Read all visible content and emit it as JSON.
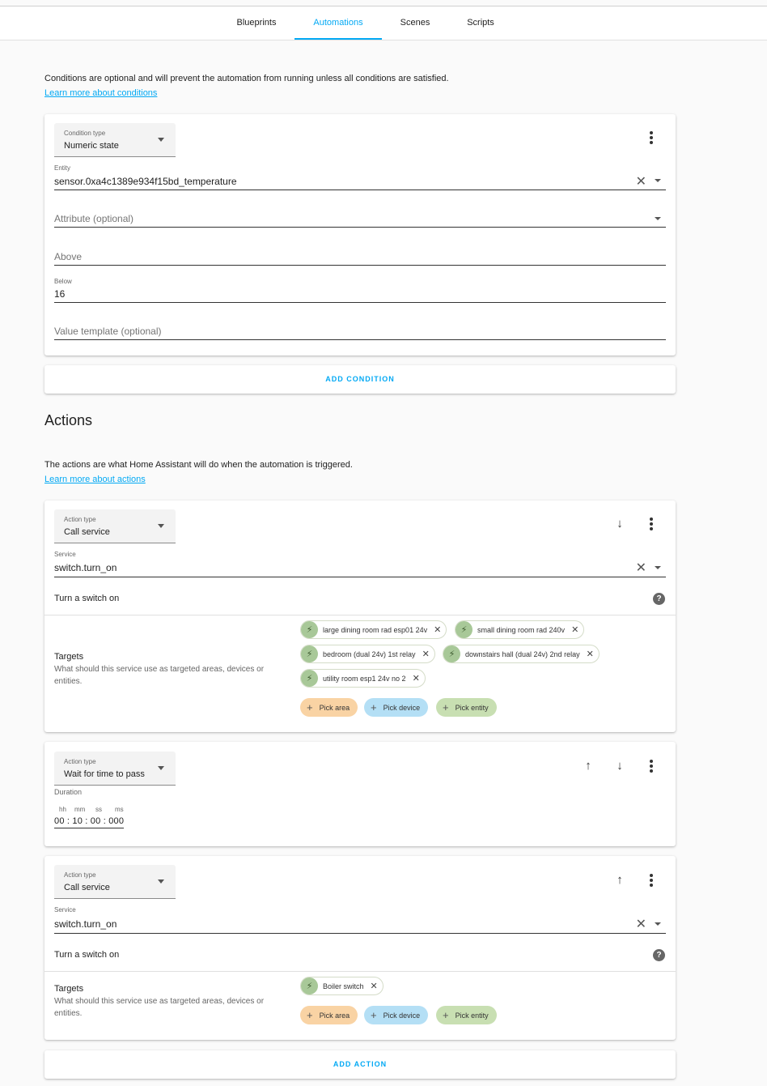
{
  "tabs": [
    "Blueprints",
    "Automations",
    "Scenes",
    "Scripts"
  ],
  "conditions": {
    "intro": "Conditions are optional and will prevent the automation from running unless all conditions are satisfied.",
    "learn_more": "Learn more about conditions",
    "card": {
      "type_label": "Condition type",
      "type_value": "Numeric state",
      "entity_label": "Entity",
      "entity_value": "sensor.0xa4c1389e934f15bd_temperature",
      "attribute_placeholder": "Attribute (optional)",
      "above_placeholder": "Above",
      "below_label": "Below",
      "below_value": "16",
      "value_template_placeholder": "Value template (optional)"
    },
    "add_button": "ADD CONDITION"
  },
  "actions": {
    "heading": "Actions",
    "intro": "The actions are what Home Assistant will do when the automation is triggered.",
    "learn_more": "Learn more about actions",
    "action1": {
      "type_label": "Action type",
      "type_value": "Call service",
      "service_label": "Service",
      "service_value": "switch.turn_on",
      "service_desc": "Turn a switch on",
      "targets_title": "Targets",
      "targets_desc": "What should this service use as targeted areas, devices or entities.",
      "chips": [
        "large dining room rad esp01 24v",
        "small dining room rad 240v",
        "bedroom (dual 24v) 1st relay",
        "downstairs hall (dual 24v) 2nd relay",
        "utility room esp1 24v no 2"
      ]
    },
    "action2": {
      "type_label": "Action type",
      "type_value": "Wait for time to pass",
      "duration_label": "Duration",
      "units": [
        "hh",
        "mm",
        "ss",
        "ms"
      ],
      "value": "00 : 10 : 00 : 000"
    },
    "action3": {
      "type_label": "Action type",
      "type_value": "Call service",
      "service_label": "Service",
      "service_value": "switch.turn_on",
      "service_desc": "Turn a switch on",
      "targets_title": "Targets",
      "targets_desc": "What should this service use as targeted areas, devices or entities.",
      "chips": [
        "Boiler switch"
      ]
    },
    "pick_area": "Pick area",
    "pick_device": "Pick device",
    "pick_entity": "Pick entity",
    "add_button": "ADD ACTION"
  },
  "colors": {
    "accent": "#03a9f4",
    "area": "#f9d3a4",
    "device": "#b4dff5",
    "entity": "#c8dfb2"
  }
}
